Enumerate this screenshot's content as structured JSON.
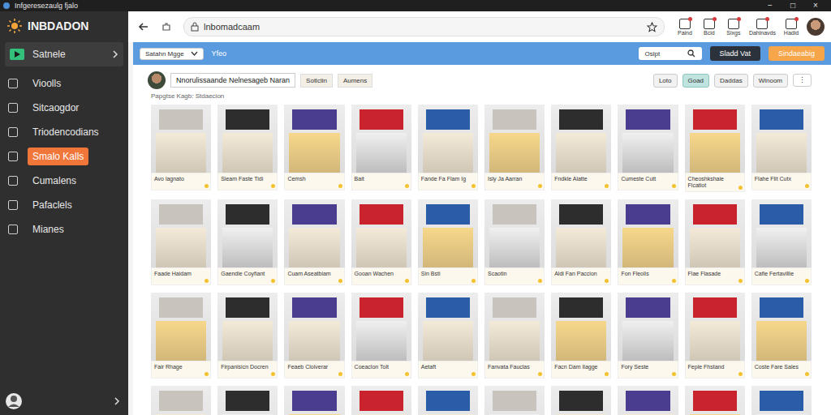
{
  "window": {
    "title": "Infgeresezaulg fjalo",
    "controls": [
      "−",
      "□",
      "×"
    ]
  },
  "sidebar": {
    "logo": "INBDADON",
    "header": {
      "label": "Satnele"
    },
    "items": [
      {
        "label": "Vioolls",
        "selected": false
      },
      {
        "label": "Sitcaogdor",
        "selected": false
      },
      {
        "label": "Triodencodians",
        "selected": false
      },
      {
        "label": "Smalo Kalls",
        "selected": true
      },
      {
        "label": "Cumalens",
        "selected": false
      },
      {
        "label": "Pafaclels",
        "selected": false
      },
      {
        "label": "Mianes",
        "selected": false
      }
    ]
  },
  "browser": {
    "address": "lnbomadcaam",
    "tools": [
      {
        "label": "Paind"
      },
      {
        "label": "Bcid"
      },
      {
        "label": "Sixgs"
      },
      {
        "label": "Dahlnavds"
      },
      {
        "label": "Hadid"
      }
    ]
  },
  "filter_bar": {
    "dropdown": "Satahn Mgge",
    "label": "Yfeo",
    "search": "Oslpt",
    "buttons": [
      {
        "label": "Sladd Vat",
        "kind": "dark"
      },
      {
        "label": "Sindaeabig",
        "kind": "accent"
      }
    ]
  },
  "page": {
    "title": "Nnorulissaande Nelnesageb Naran",
    "actions": [
      "Sotlclin",
      "Aumens"
    ],
    "chips": [
      {
        "label": "Loto",
        "selected": false
      },
      {
        "label": "Goad",
        "selected": true
      },
      {
        "label": "Daddas",
        "selected": false
      },
      {
        "label": "Winoom",
        "selected": false
      }
    ],
    "more": "⋮",
    "subtitle": "Papgtse Kagb: Stdaecion"
  },
  "grid": {
    "cards": [
      {
        "caption": "Avo lagnato"
      },
      {
        "caption": "Sieam Faste Tidi"
      },
      {
        "caption": "Cemsh"
      },
      {
        "caption": "Bait"
      },
      {
        "caption": "Fande Fa Flam Ig"
      },
      {
        "caption": "Isly Ja Aarran"
      },
      {
        "caption": "Fndkle Alatte"
      },
      {
        "caption": "Cumeste Cutt"
      },
      {
        "caption": "Cheoshkshaie Flcatiot"
      },
      {
        "caption": "Flahe Flit Cutx"
      },
      {
        "caption": "Faade Haidam"
      },
      {
        "caption": "Gaendie Coyfiant"
      },
      {
        "caption": "Cuam Aseatbiam"
      },
      {
        "caption": "Gooan Wachen"
      },
      {
        "caption": "Sin Bsti"
      },
      {
        "caption": "Scaotin"
      },
      {
        "caption": "Aldi Fan Paccion"
      },
      {
        "caption": "Fon Fleolis"
      },
      {
        "caption": "Flae Flasade"
      },
      {
        "caption": "Cafie Fertavillie"
      },
      {
        "caption": "Fair Rhage"
      },
      {
        "caption": "Firpanisicn Docren"
      },
      {
        "caption": "Feaeb Cloiverar"
      },
      {
        "caption": "Coeaclon Tolt"
      },
      {
        "caption": "Aetaft"
      },
      {
        "caption": "Fanvata Fauclas"
      },
      {
        "caption": "Facn Dam Ilagge"
      },
      {
        "caption": "Fory Seste"
      },
      {
        "caption": "Feple Fhstand"
      },
      {
        "caption": "Coste Fare Sales"
      },
      {
        "caption": ""
      },
      {
        "caption": ""
      },
      {
        "caption": ""
      },
      {
        "caption": ""
      },
      {
        "caption": ""
      },
      {
        "caption": ""
      },
      {
        "caption": ""
      },
      {
        "caption": ""
      },
      {
        "caption": ""
      },
      {
        "caption": ""
      }
    ]
  }
}
